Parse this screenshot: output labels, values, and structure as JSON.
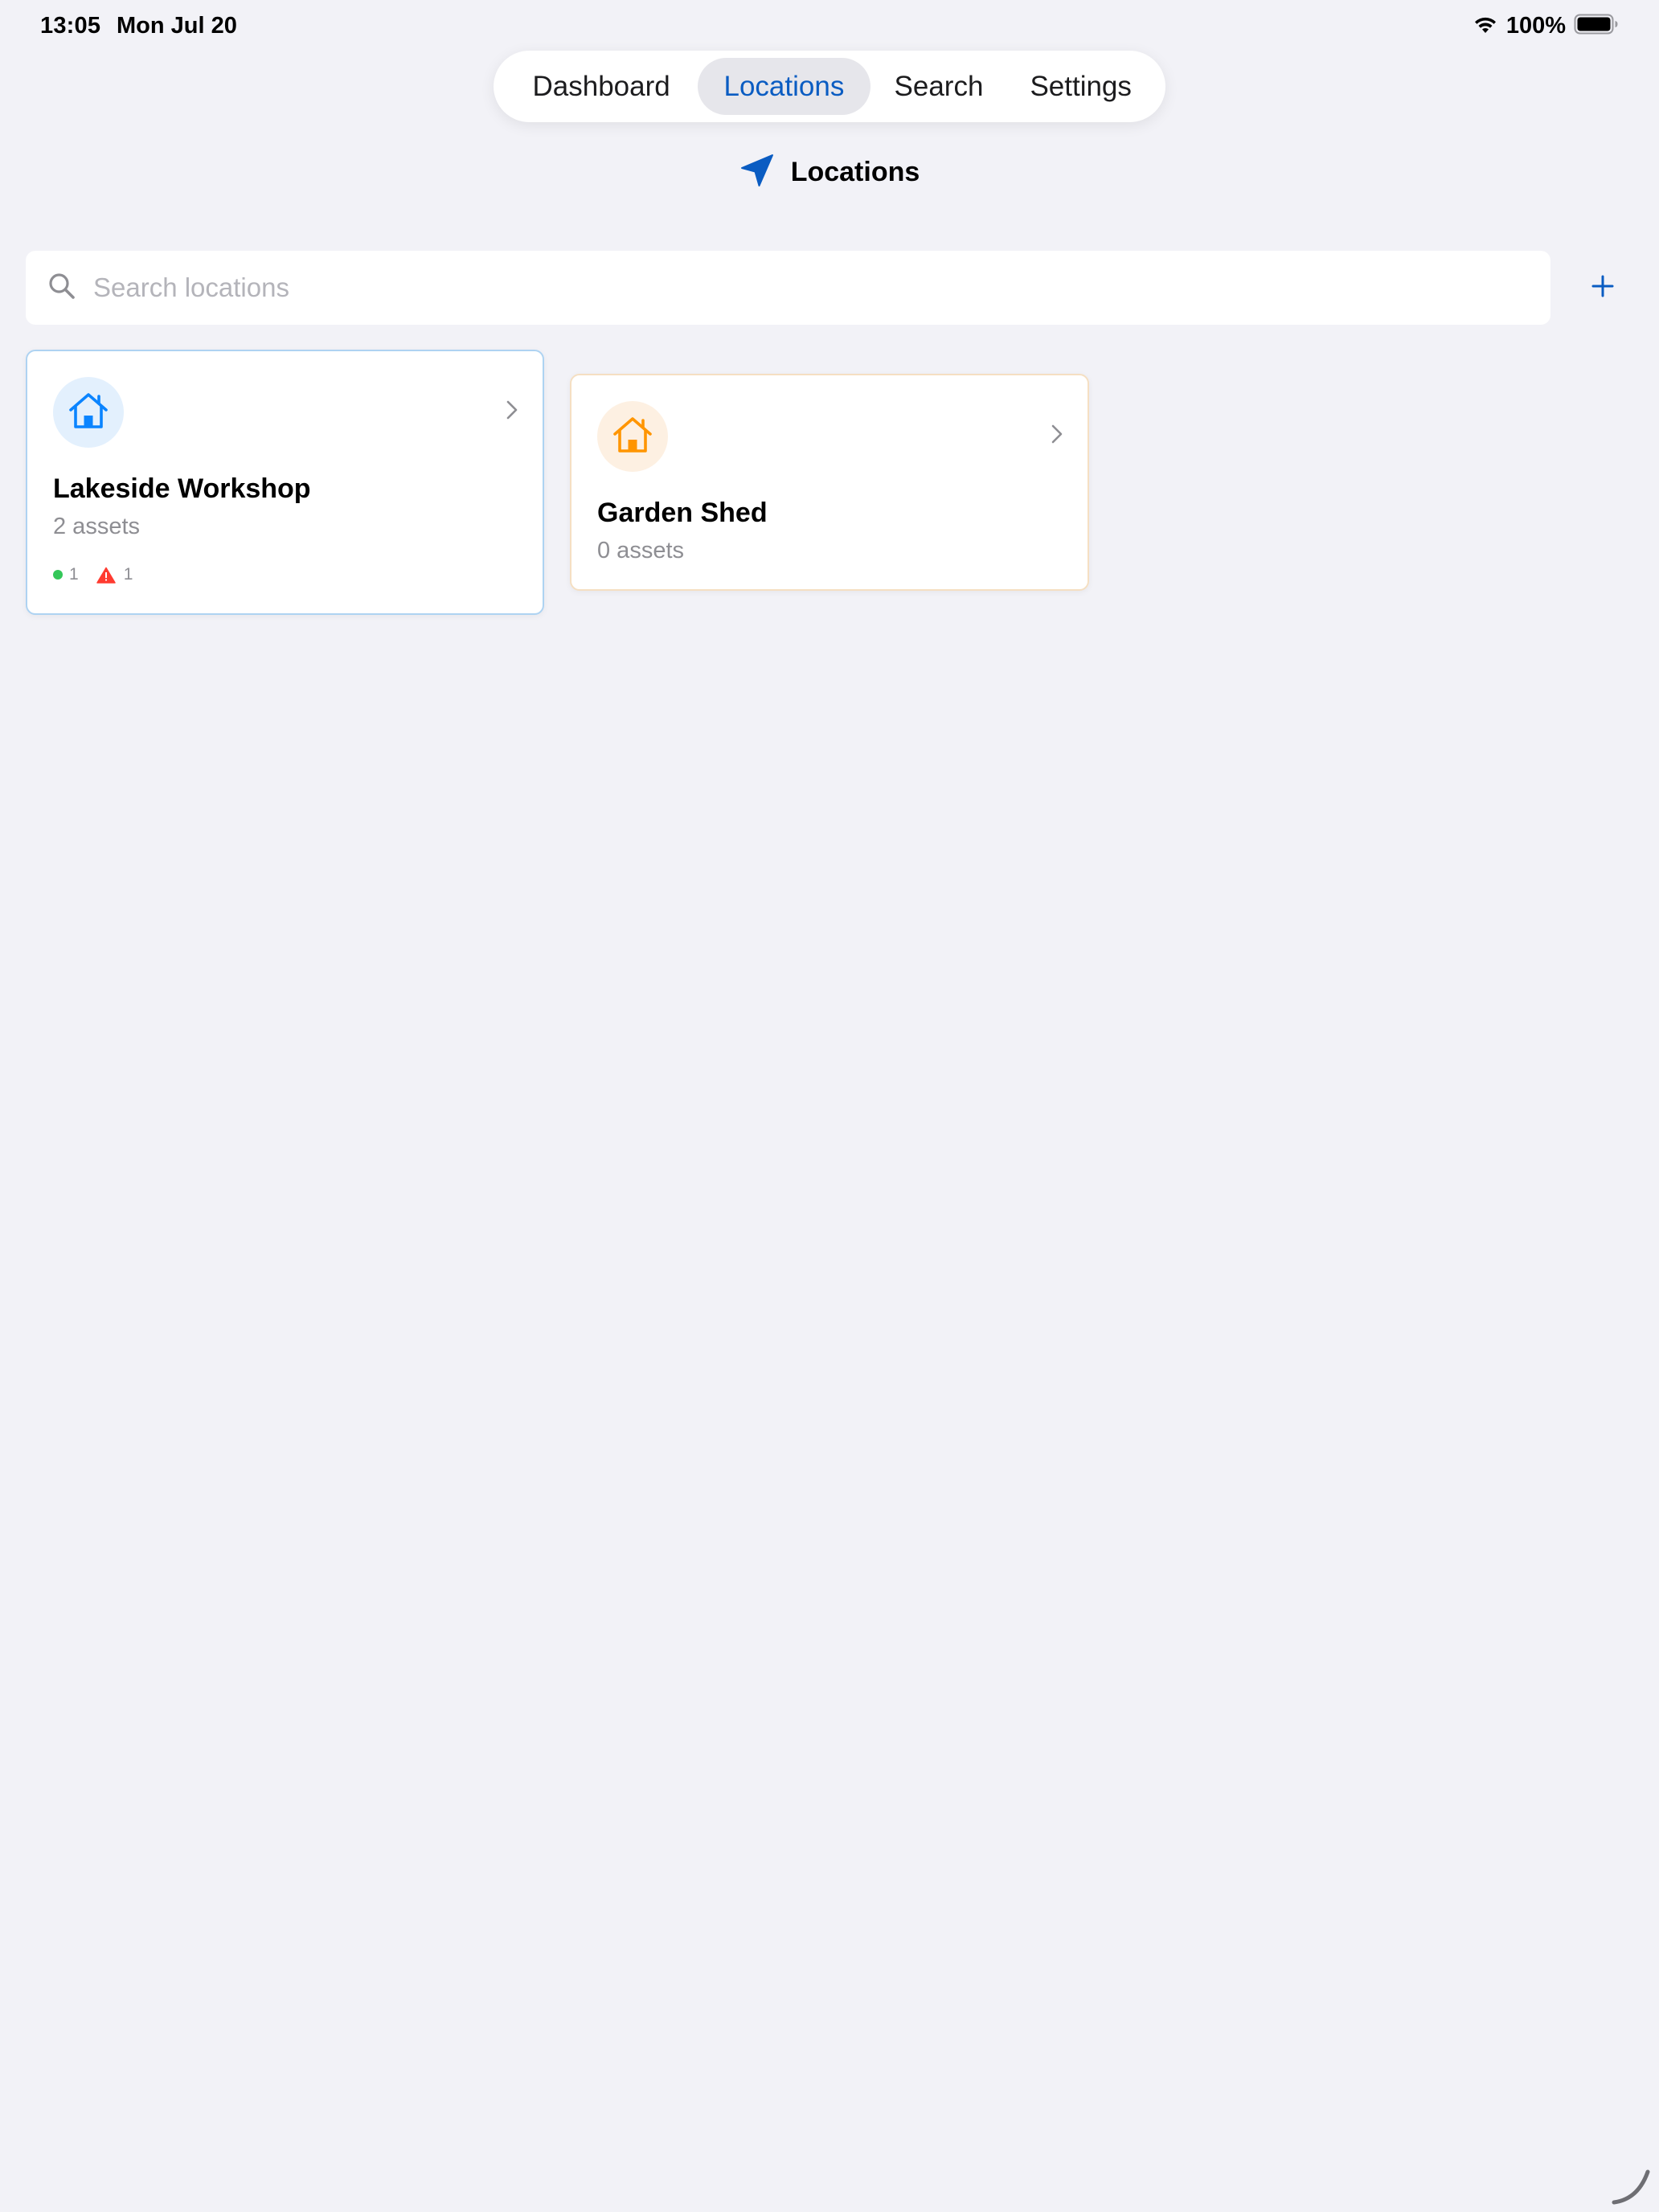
{
  "status_bar": {
    "time": "13:05",
    "date": "Mon Jul 20",
    "battery": "100%"
  },
  "tabs": [
    {
      "label": "Dashboard",
      "active": false
    },
    {
      "label": "Locations",
      "active": true
    },
    {
      "label": "Search",
      "active": false
    },
    {
      "label": "Settings",
      "active": false
    }
  ],
  "header": {
    "title": "Locations",
    "icon": "location-arrow-icon"
  },
  "search": {
    "placeholder": "Search locations",
    "value": ""
  },
  "add_button": {
    "icon": "plus-icon"
  },
  "locations": [
    {
      "name": "Lakeside Workshop",
      "asset_count": "2 assets",
      "icon": "house-icon",
      "accent_color": "#0a84ff",
      "stats": {
        "ok_count": "1",
        "warning_count": "1"
      }
    },
    {
      "name": "Garden Shed",
      "asset_count": "0 assets",
      "icon": "house-icon",
      "accent_color": "#ff9500"
    }
  ],
  "colors": {
    "accent": "#0a5cc2",
    "background": "#f2f2f7",
    "ok": "#34c759",
    "warning": "#ff3b30"
  }
}
